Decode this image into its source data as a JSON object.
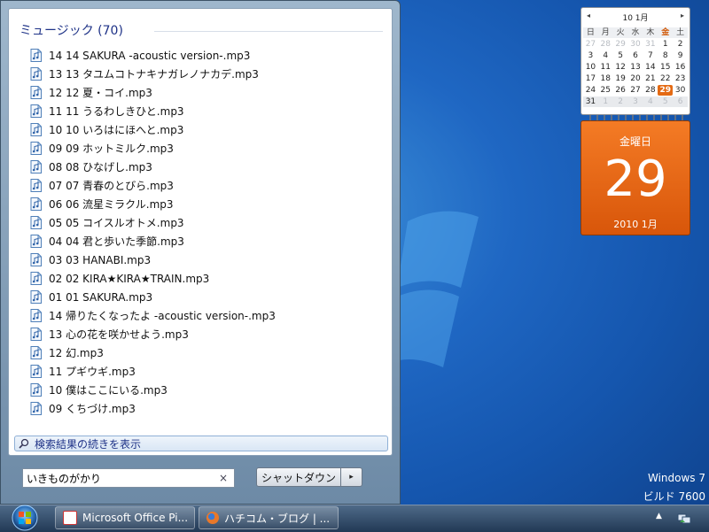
{
  "start_menu": {
    "group_header": "ミュージック (70)",
    "files": [
      "14 14 SAKURA -acoustic version-.mp3",
      "13 13 タユムコトナキナガレノナカデ.mp3",
      "12 12 夏・コイ.mp3",
      "11 11 うるわしきひと.mp3",
      "10 10 いろはにほへと.mp3",
      "09 09 ホットミルク.mp3",
      "08 08 ひなげし.mp3",
      "07 07 青春のとびら.mp3",
      "06 06 流星ミラクル.mp3",
      "05 05 コイスルオトメ.mp3",
      "04 04 君と歩いた季節.mp3",
      "03 03 HANABI.mp3",
      "02 02 KIRA★KIRA★TRAIN.mp3",
      "01 01 SAKURA.mp3",
      "14 帰りたくなったよ -acoustic version-.mp3",
      "13 心の花を咲かせよう.mp3",
      "12 幻.mp3",
      "11 プギウギ.mp3",
      "10 僕はここにいる.mp3",
      "09 くちづけ.mp3"
    ],
    "see_more": "検索結果の続きを表示",
    "search_value": "いきものがかり",
    "clear_symbol": "×",
    "shutdown_label": "シャットダウン",
    "shutdown_arrow": "▸"
  },
  "calendar": {
    "header": "10 1月",
    "prev": "◂",
    "next": "▸",
    "weekdays": [
      "日",
      "月",
      "火",
      "水",
      "木",
      "金",
      "土"
    ],
    "weeks": [
      [
        "27",
        "28",
        "29",
        "30",
        "31",
        "1",
        "2"
      ],
      [
        "3",
        "4",
        "5",
        "6",
        "7",
        "8",
        "9"
      ],
      [
        "10",
        "11",
        "12",
        "13",
        "14",
        "15",
        "16"
      ],
      [
        "17",
        "18",
        "19",
        "20",
        "21",
        "22",
        "23"
      ],
      [
        "24",
        "25",
        "26",
        "27",
        "28",
        "29",
        "30"
      ],
      [
        "31",
        "1",
        "2",
        "3",
        "4",
        "5",
        "6"
      ]
    ],
    "today": "29"
  },
  "date_card": {
    "weekday": "金曜日",
    "day": "29",
    "month": "2010 1月"
  },
  "watermark": {
    "line1": "Windows 7",
    "line2": "ビルド 7600"
  },
  "taskbar": {
    "buttons": [
      {
        "label": "Microsoft Office Pi...",
        "icon": "office-picture-icon"
      },
      {
        "label": "ハチコム・ブログ | ...",
        "icon": "firefox-icon"
      }
    ],
    "tray_arrow": "▲"
  },
  "colors": {
    "desktop": "#1f67c3",
    "calendar_today": "#e46a13",
    "date_card": "#e8630f",
    "link_blue": "#1e3287"
  }
}
